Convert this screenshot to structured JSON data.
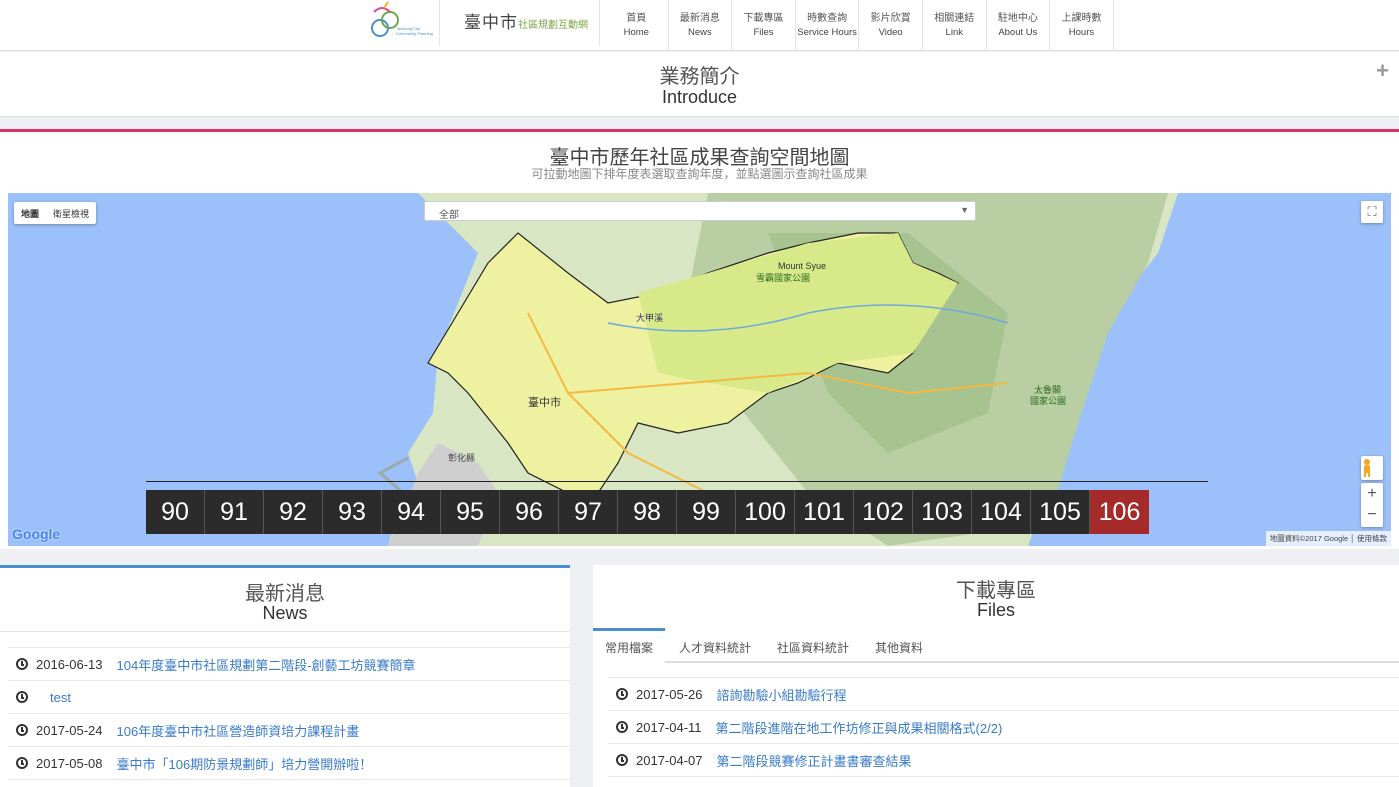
{
  "header": {
    "logo_site": "臺中市",
    "logo_subtitle": "社區規劃互動網",
    "logo_tagline": "Taichung City Community Planning Team Empowering Service",
    "nav": [
      {
        "zh": "首頁",
        "en": "Home"
      },
      {
        "zh": "最新消息",
        "en": "News"
      },
      {
        "zh": "下載專區",
        "en": "Files"
      },
      {
        "zh": "時數查詢",
        "en": "Service Hours"
      },
      {
        "zh": "影片欣賞",
        "en": "Video"
      },
      {
        "zh": "相關連結",
        "en": "Link"
      },
      {
        "zh": "駐地中心",
        "en": "About Us"
      },
      {
        "zh": "上課時數",
        "en": "Hours"
      }
    ]
  },
  "intro": {
    "zh": "業務簡介",
    "en": "Introduce",
    "expand_icon": "plus-icon"
  },
  "map_section": {
    "title": "臺中市歷年社區成果查詢空間地圖",
    "subtitle": "可拉動地圖下排年度表選取查詢年度，並點選圖示查詢社區成果",
    "map_type": [
      "地圖",
      "衛星檢視"
    ],
    "year_select_value": "全部",
    "labels": {
      "city": "臺中市",
      "changhua": "彰化縣",
      "mountain": "Mount Syue",
      "park1": "雪霸國家公園",
      "park2": "太魯閣",
      "park2b": "國家公園",
      "river": "大甲溪"
    },
    "google": "Google",
    "attribution": "地圖資料©2017 Google │ 使用條款",
    "years": [
      "90",
      "91",
      "92",
      "93",
      "94",
      "95",
      "96",
      "97",
      "98",
      "99",
      "100",
      "101",
      "102",
      "103",
      "104",
      "105",
      "106"
    ],
    "active_year": "106",
    "colors": {
      "sea": "#9cc0f9",
      "active_year": "#a52a2a",
      "accent": "#d8366b"
    }
  },
  "news": {
    "zh": "最新消息",
    "en": "News",
    "items": [
      {
        "date": "2016-06-13",
        "title": "104年度臺中市社區規劃第二階段-創藝工坊競賽簡章"
      },
      {
        "date": "",
        "title": "test"
      },
      {
        "date": "2017-05-24",
        "title": "106年度臺中市社區營造師資培力課程計畫"
      },
      {
        "date": "2017-05-08",
        "title": "臺中市「106期防景規劃師」培力營開辦啦！"
      }
    ]
  },
  "files": {
    "zh": "下載專區",
    "en": "Files",
    "tabs": [
      "常用檔案",
      "人才資料統計",
      "社區資料統計",
      "其他資料"
    ],
    "items": [
      {
        "date": "2017-05-26",
        "title": "諮詢勘驗小組勘驗行程"
      },
      {
        "date": "2017-04-11",
        "title": "第二階段進階在地工作坊修正與成果相關格式(2/2)"
      },
      {
        "date": "2017-04-07",
        "title": "第二階段競賽修正計畫書審查結果"
      }
    ]
  }
}
